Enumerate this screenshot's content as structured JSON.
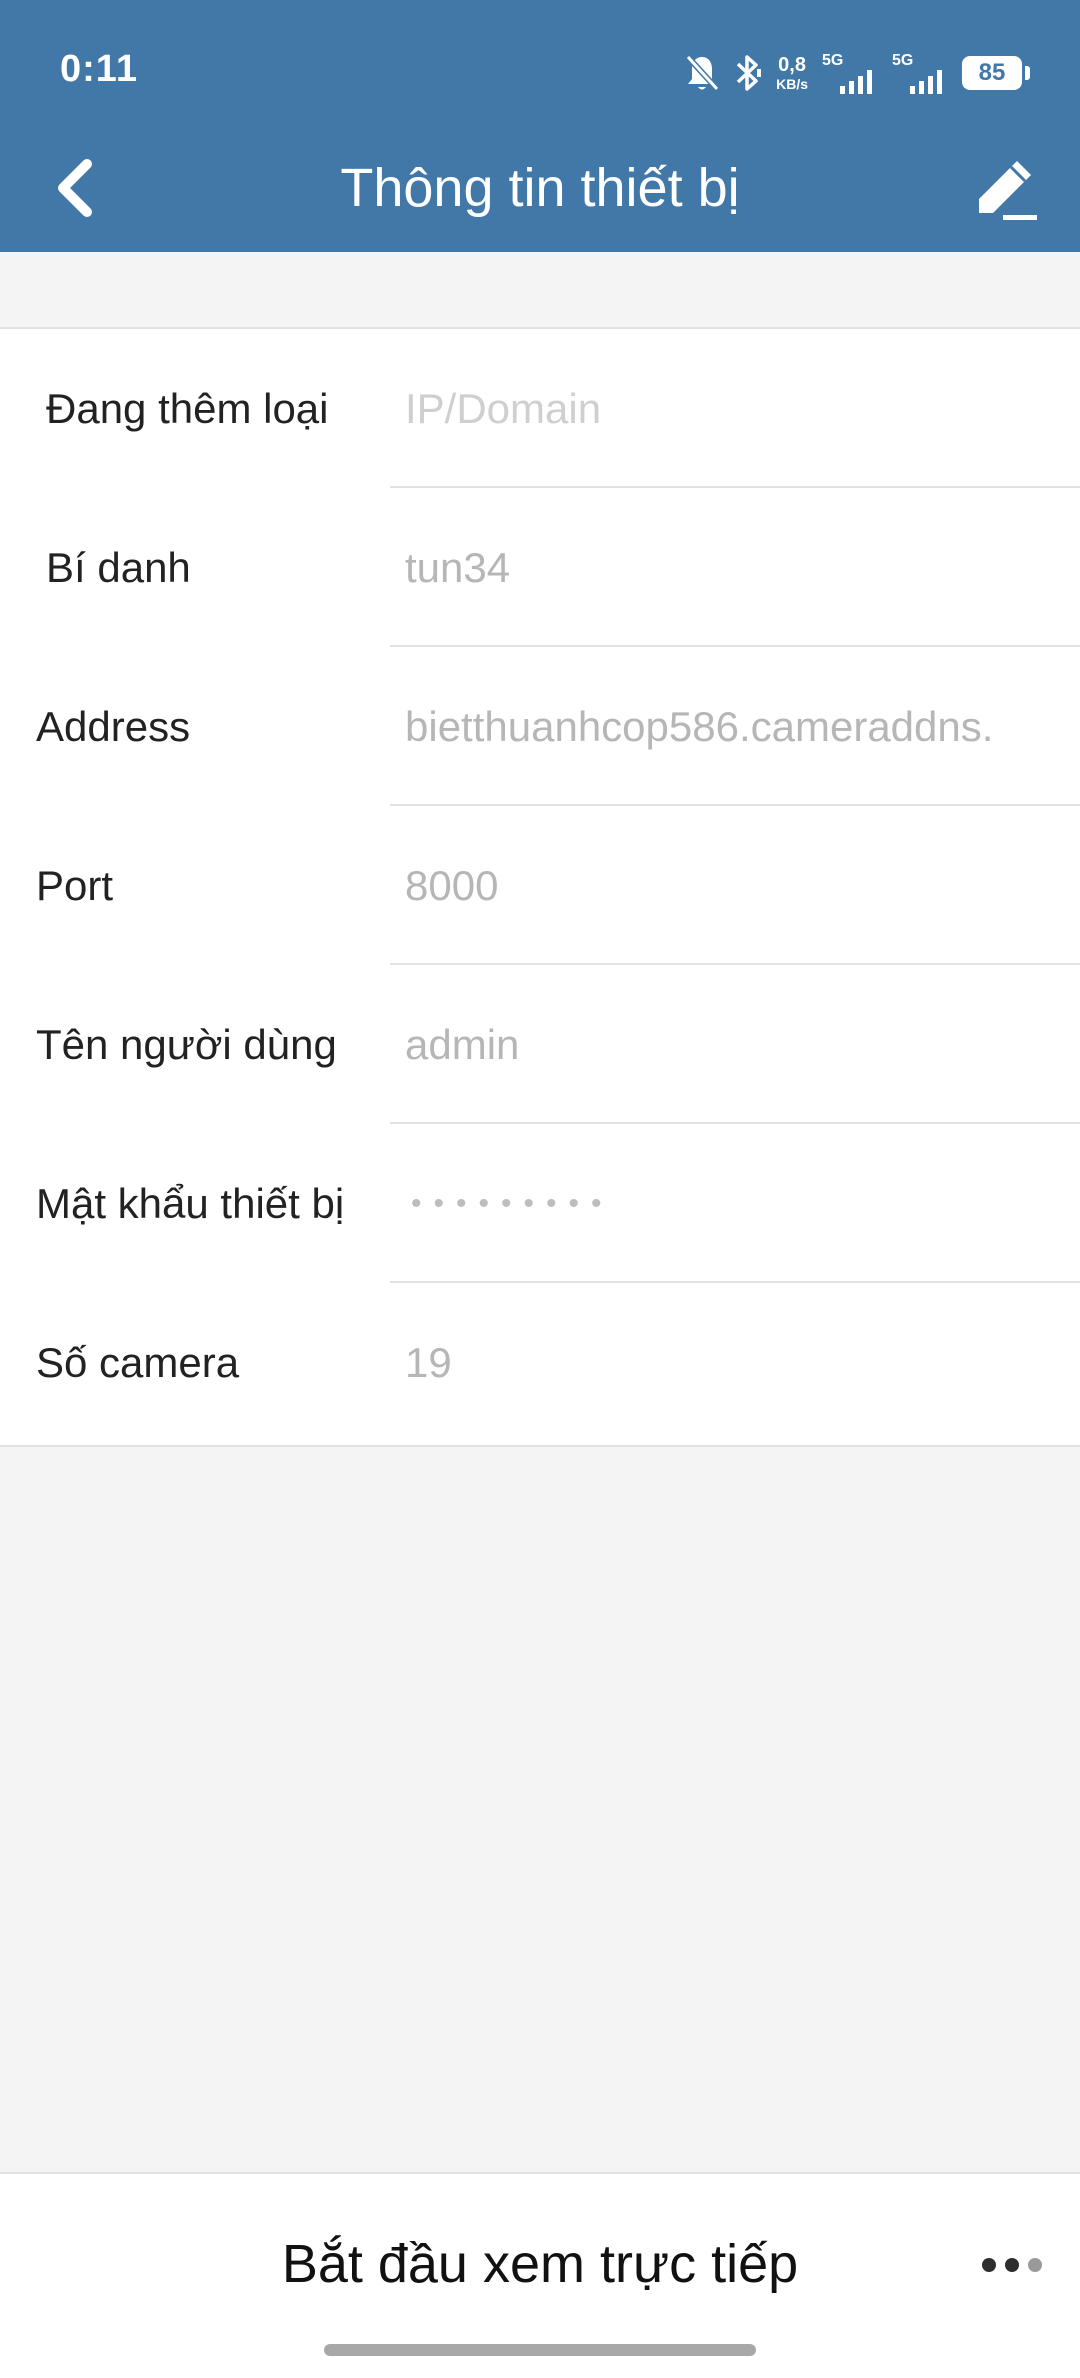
{
  "status_bar": {
    "time": "0:11",
    "net_speed_value": "0,8",
    "net_speed_unit": "KB/s",
    "sim1_label": "5G",
    "sim2_label": "5G",
    "battery": "85",
    "icons": [
      "bell-muted-icon",
      "bluetooth-icon",
      "signal-icon",
      "signal-icon",
      "battery-icon"
    ]
  },
  "header": {
    "title": "Thông tin thiết bị",
    "back_icon": "chevron-left-icon",
    "edit_icon": "pencil-icon"
  },
  "form": {
    "fields": [
      {
        "label": "Đang thêm loại",
        "value": "IP/Domain"
      },
      {
        "label": "Bí danh",
        "value": "tun34"
      },
      {
        "label": "Address",
        "value": "bietthuanhcop586.cameraddns."
      },
      {
        "label": "Port",
        "value": "8000"
      },
      {
        "label": "Tên người dùng",
        "value": "admin"
      },
      {
        "label": "Mật khẩu thiết bị",
        "value": "•••••••••"
      },
      {
        "label": "Số camera",
        "value": "19"
      }
    ]
  },
  "bottom_bar": {
    "live_label": "Bắt đầu xem trực tiếp",
    "more_icon": "more-dots-icon"
  },
  "colors": {
    "header_bg": "#4178a8",
    "page_bg": "#f4f4f4",
    "value_text": "#b6b6b6",
    "label_text": "#222222"
  }
}
